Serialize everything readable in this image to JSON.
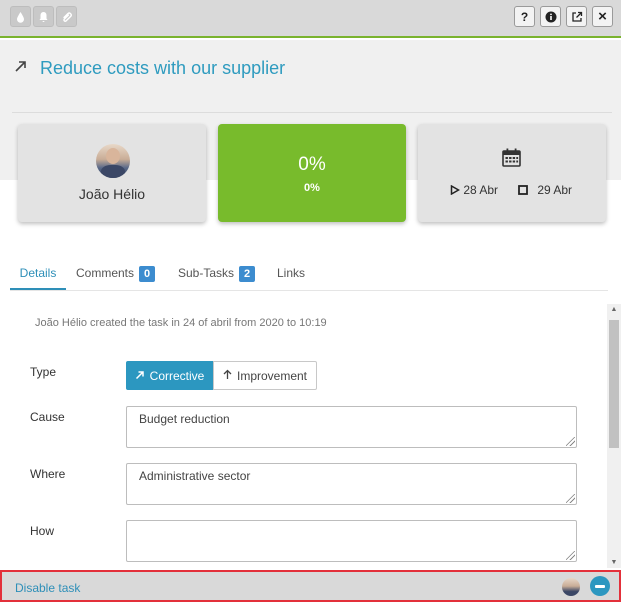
{
  "toolbar": {
    "left_icons": [
      "drop-icon",
      "bell-icon",
      "paperclip-icon"
    ],
    "right_buttons": {
      "help": "?",
      "info": "i",
      "close": "×"
    },
    "accent": "#7ab32e"
  },
  "header": {
    "title": "Reduce costs with our supplier"
  },
  "cards": {
    "user_name": "João Hélio",
    "progress_big": "0%",
    "progress_small": "0%",
    "progress_value": 0,
    "start_date": "28 Abr",
    "end_date": "29 Abr"
  },
  "tabs": [
    {
      "label": "Details",
      "active": true
    },
    {
      "label": "Comments",
      "count": "0"
    },
    {
      "label": "Sub-Tasks",
      "count": "2"
    },
    {
      "label": "Links"
    }
  ],
  "details": {
    "created_text": "João Hélio created the task in 24 of abril from 2020 to 10:19",
    "type_label": "Type",
    "type_options": {
      "corrective": "Corrective",
      "improvement": "Improvement",
      "selected": "Corrective"
    },
    "cause_label": "Cause",
    "cause_value": "Budget reduction",
    "where_label": "Where",
    "where_value": "Administrative sector",
    "how_label": "How",
    "how_value": ""
  },
  "footer": {
    "disable_label": "Disable task"
  },
  "colors": {
    "link": "#2e8fb8",
    "progress_card": "#78bb2c",
    "badge": "#3c8ccf",
    "footer_highlight": "#e3303a"
  }
}
